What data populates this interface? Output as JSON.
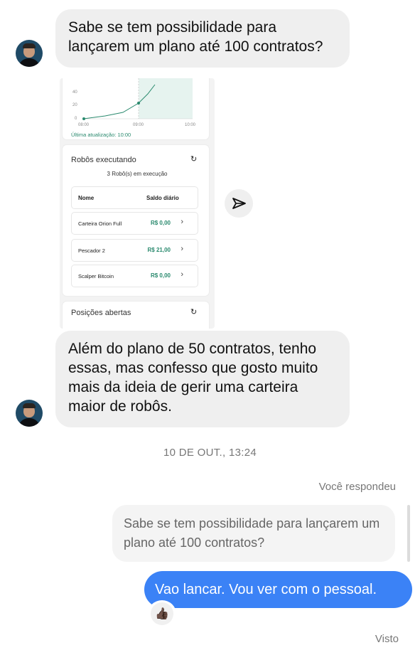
{
  "messages": {
    "incoming_1": "Sabe se tem possibilidade para lançarem um plano até 100 contratos?",
    "incoming_2": "Além do plano de 50 contratos, tenho essas, mas confesso que gosto muito mais da ideia de gerir uma carteira maior de robôs."
  },
  "shared_screenshot": {
    "chart": {
      "y_ticks": [
        "40",
        "20",
        "0"
      ],
      "x_ticks": [
        "08:00",
        "09:00",
        "10:00"
      ],
      "last_update": "Última atualização: 10:00",
      "accent": "#2a8a6e"
    },
    "robots": {
      "title": "Robôs executando",
      "subtitle": "3 Robô(s) em execução",
      "header_name": "Nome",
      "header_balance": "Saldo diário",
      "rows": [
        {
          "name": "Carteira Orion Full",
          "value": "R$ 0,00"
        },
        {
          "name": "Pescador 2",
          "value": "R$ 21,00"
        },
        {
          "name": "Scalper Bitcoin",
          "value": "R$ 0,00"
        }
      ],
      "refresh_icon": "refresh-icon"
    },
    "positions": {
      "title": "Posições abertas"
    }
  },
  "timestamp": "10 DE OUT., 13:24",
  "you_replied": "Você respondeu",
  "reply_quote": "Sabe se tem possibilidade para lançarem um plano até 100 contratos?",
  "outgoing_1": "Vao lancar. Vou ver com o pessoal.",
  "reaction_emoji": "👍🏿",
  "seen": "Visto",
  "colors": {
    "outgoing_bubble": "#3b82f6",
    "incoming_bubble": "#efefef"
  }
}
